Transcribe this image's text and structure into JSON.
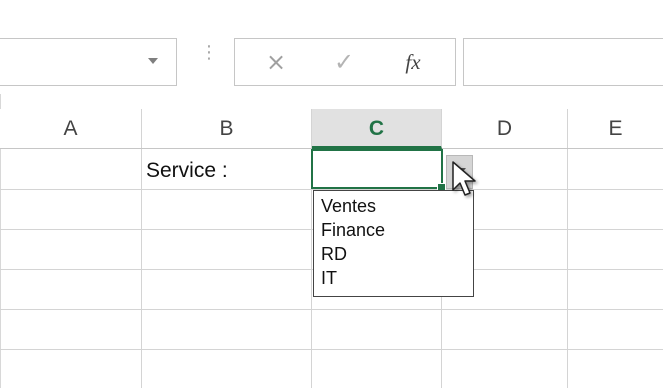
{
  "formula_bar": {
    "cancel_icon": "×",
    "enter_icon": "✓",
    "insert_function_label": "fx",
    "separator": "⋮"
  },
  "columns": [
    {
      "label": "A"
    },
    {
      "label": "B"
    },
    {
      "label": "C"
    },
    {
      "label": "D"
    },
    {
      "label": "E"
    }
  ],
  "active_column": "C",
  "cells": {
    "b_label": "Service :"
  },
  "dropdown": {
    "items": [
      "Ventes",
      "Finance",
      "RD",
      "IT"
    ]
  },
  "colors": {
    "accent": "#217346",
    "header_active_bg": "#e1e1e1",
    "gridline": "#d4d4d4"
  }
}
